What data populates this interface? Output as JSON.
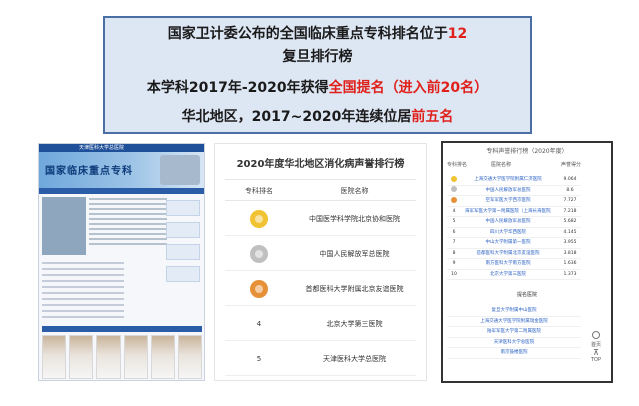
{
  "title_box": {
    "line1_prefix": "国家卫计委公布的全国临床重点专科排名位于",
    "line1_highlight": "12",
    "line2": "复旦排行榜",
    "line3_prefix": "本学科2017年-2020年获得",
    "line3_highlight": "全国提名（进入前20名）",
    "line4_prefix": "华北地区，2017~2020年连续位居",
    "line4_highlight": "前五名",
    "colors": {
      "background": "#dde6f3",
      "border": "#4a6fa5",
      "highlight": "#e0201b"
    }
  },
  "left_panel": {
    "banner_title": "国家临床重点专科",
    "top_bar_text": "天津医科大学总医院"
  },
  "middle_panel": {
    "title": "2020年度华北地区消化病声誉排行榜",
    "col_rank": "专科排名",
    "col_hospital": "医院名称",
    "rows": [
      {
        "rank": "1",
        "medal": "gold",
        "hospital": "中国医学科学院北京协和医院"
      },
      {
        "rank": "2",
        "medal": "silver",
        "hospital": "中国人民解放军总医院"
      },
      {
        "rank": "3",
        "medal": "bronze",
        "hospital": "首都医科大学附属北京友谊医院"
      },
      {
        "rank": "4",
        "medal": "",
        "hospital": "北京大学第三医院"
      },
      {
        "rank": "5",
        "medal": "",
        "hospital": "天津医科大学总医院"
      }
    ]
  },
  "right_panel": {
    "title": "专科声誉排行榜（2020年度）",
    "col_rank": "专科排名",
    "col_hospital": "医院名称",
    "col_score": "声誉得分",
    "rows": [
      {
        "rank": "1",
        "hospital": "上海交通大学医学院附属仁济医院",
        "score": "9.064"
      },
      {
        "rank": "2",
        "hospital": "中国人民解放军总医院",
        "score": "8.6"
      },
      {
        "rank": "3",
        "hospital": "空军军医大学西京医院",
        "score": "7.727"
      },
      {
        "rank": "4",
        "hospital": "海军军医大学第一附属医院（上海长海医院）",
        "score": "7.218"
      },
      {
        "rank": "5",
        "hospital": "中国人民解放军总医院",
        "score": "5.682"
      },
      {
        "rank": "6",
        "hospital": "四川大学华西医院",
        "score": "4.145"
      },
      {
        "rank": "7",
        "hospital": "中山大学附属第一医院",
        "score": "3.955"
      },
      {
        "rank": "8",
        "hospital": "首都医科大学附属北京友谊医院",
        "score": "3.818"
      },
      {
        "rank": "9",
        "hospital": "南方医科大学南方医院",
        "score": "1.636"
      },
      {
        "rank": "10",
        "hospital": "北京大学第三医院",
        "score": "1.373"
      }
    ],
    "nominated_title": "提名医院",
    "nominated": [
      "复旦大学附属中山医院",
      "上海交通大学医学院附属瑞金医院",
      "陆军军医大学第二附属医院",
      "天津医科大学总医院",
      "南京鼓楼医院"
    ],
    "side_home_label": "首页",
    "side_top_label": "TOP"
  }
}
